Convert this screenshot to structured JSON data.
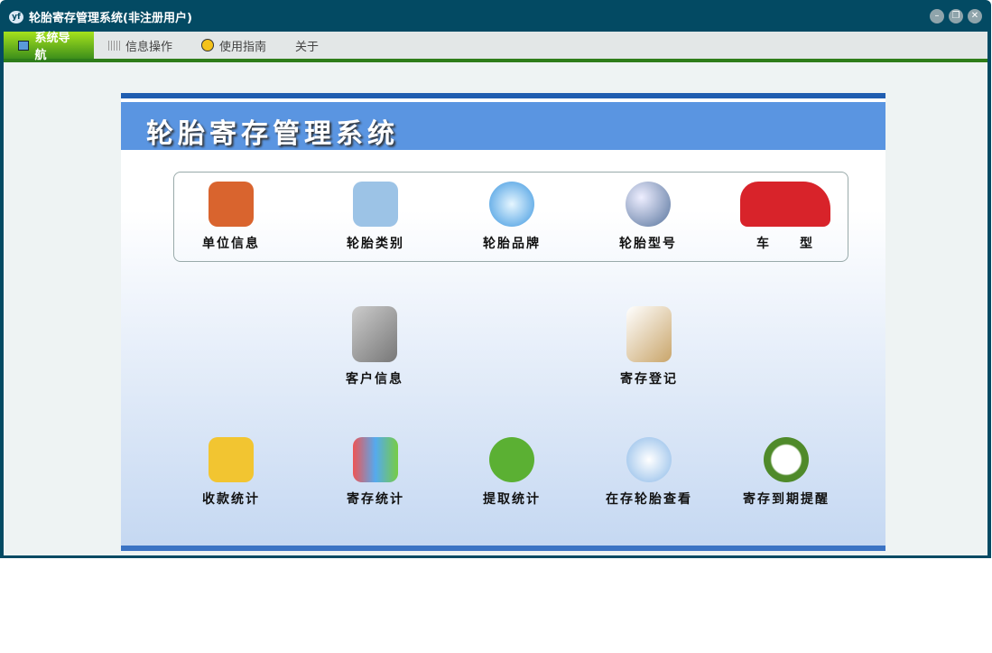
{
  "window": {
    "title": "轮胎寄存管理系统(非注册用户)",
    "logo": "yf"
  },
  "menu": [
    {
      "label": "系统导航",
      "icon": "monitor-icon"
    },
    {
      "label": "信息操作",
      "icon": "grid-icon"
    },
    {
      "label": "使用指南",
      "icon": "help-icon"
    },
    {
      "label": "关于"
    }
  ],
  "banner": "轮胎寄存管理系统",
  "row1": [
    "单位信息",
    "轮胎类别",
    "轮胎品牌",
    "轮胎型号",
    "车　　型"
  ],
  "row2": [
    "客户信息",
    "寄存登记"
  ],
  "row3": [
    "收款统计",
    "寄存统计",
    "提取统计",
    "在存轮胎查看",
    "寄存到期提醒"
  ]
}
